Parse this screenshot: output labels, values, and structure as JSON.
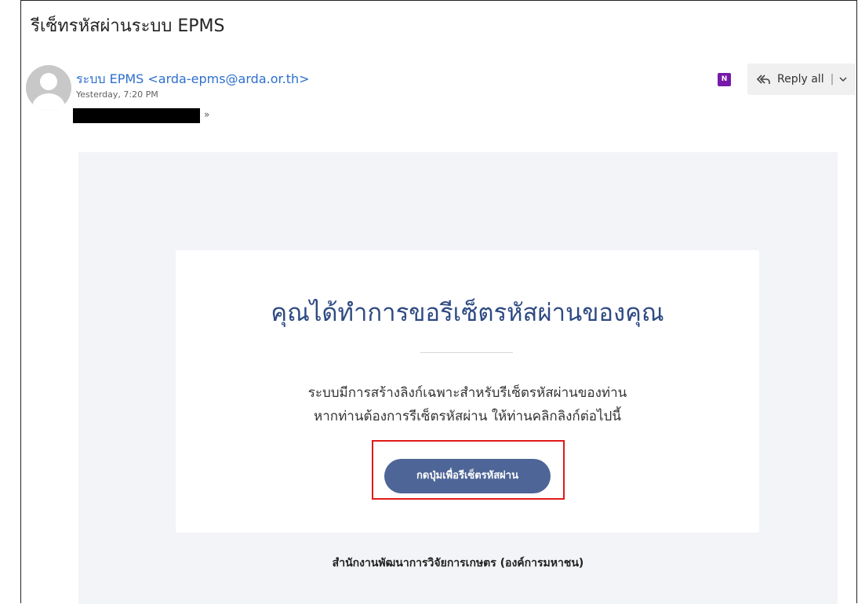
{
  "email": {
    "subject": "รีเซ็ทรหัสผ่านระบบ EPMS",
    "sender": "ระบบ EPMS <arda-epms@arda.or.th>",
    "date": "Yesterday, 7:20 PM",
    "expand_icon": "chevron-double-down-icon"
  },
  "toolbar": {
    "onenote_icon": "onenote-icon",
    "onenote_glyph": "N",
    "reply_all_label": "Reply all",
    "separator": "|"
  },
  "message": {
    "heading": "คุณได้ทำการขอรีเซ็ตรหัสผ่านของคุณ",
    "line1": "ระบบมีการสร้างลิงก์เฉพาะสำหรับรีเซ็ตรหัสผ่านของท่าน",
    "line2": "หากท่านต้องการรีเซ็ตรหัสผ่าน ให้ท่านคลิกลิงก์ต่อไปนี้",
    "button_label": "กดปุ่มเพื่อรีเซ็ตรหัสผ่าน",
    "footer": "สำนักงานพัฒนาการวิจัยการเกษตร (องค์การมหาชน)"
  },
  "colors": {
    "accent": "#2e4a82",
    "button": "#4e6597",
    "link": "#2e6fce",
    "highlight": "#e01919",
    "onenote": "#7719aa"
  }
}
